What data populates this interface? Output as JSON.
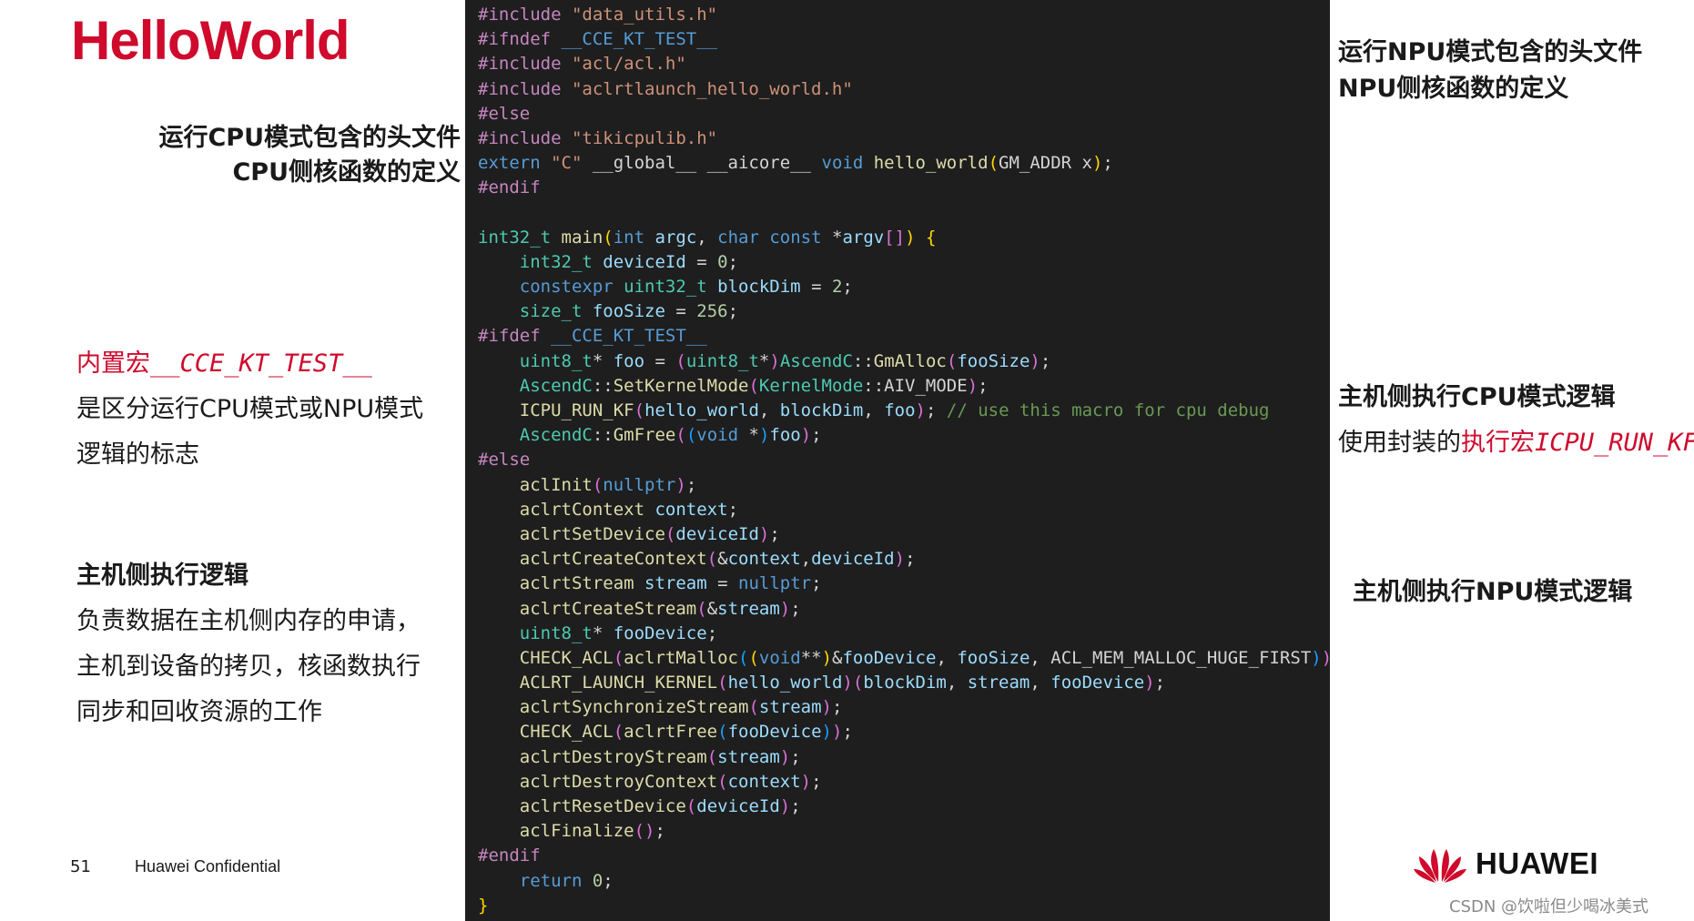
{
  "slide": {
    "title": "HelloWorld",
    "left": {
      "cpu_header_line1": "运行CPU模式包含的头文件",
      "cpu_header_line2": "CPU侧核函数的定义",
      "macro_name": "内置宏",
      "macro_code": "__CCE_KT_TEST__",
      "macro_line2": "是区分运行CPU模式或NPU模式",
      "macro_line3": "逻辑的标志",
      "host_head": "主机侧执行逻辑",
      "host_line1": "负责数据在主机侧内存的申请，",
      "host_line2": "主机到设备的拷贝，核函数执行",
      "host_line3": "同步和回收资源的工作"
    },
    "right": {
      "npu_header_line1": "运行NPU模式包含的头文件",
      "npu_header_line2": "NPU侧核函数的定义",
      "cpu_logic_head": "主机侧执行CPU模式逻辑",
      "cpu_logic_prefix": "使用封装的",
      "cpu_logic_red": "执行宏",
      "cpu_logic_code": "ICPU_RUN_KF",
      "npu_logic_head": "主机侧执行NPU模式逻辑"
    },
    "footer": {
      "page_number": "51",
      "confidential": "Huawei Confidential",
      "logo_text": "HUAWEI",
      "watermark": "CSDN @饮啦但少喝冰美式"
    }
  },
  "code": {
    "language": "cpp",
    "lines": [
      [
        [
          "pp",
          "#include "
        ],
        [
          "str",
          "\"data_utils.h\""
        ]
      ],
      [
        [
          "pp",
          "#ifndef "
        ],
        [
          "mac",
          "__CCE_KT_TEST__"
        ]
      ],
      [
        [
          "pp",
          "#include "
        ],
        [
          "str",
          "\"acl/acl.h\""
        ]
      ],
      [
        [
          "pp",
          "#include "
        ],
        [
          "str",
          "\"aclrtlaunch_hello_world.h\""
        ]
      ],
      [
        [
          "pp",
          "#else"
        ]
      ],
      [
        [
          "pp",
          "#include "
        ],
        [
          "str",
          "\"tikicpulib.h\""
        ]
      ],
      [
        [
          "kw",
          "extern "
        ],
        [
          "str",
          "\"C\" "
        ],
        [
          "pun",
          "__global__ __aicore__ "
        ],
        [
          "kw",
          "void "
        ],
        [
          "fn",
          "hello_world"
        ],
        [
          "br1",
          "("
        ],
        [
          "pun",
          "GM_ADDR x"
        ],
        [
          "br1",
          ")"
        ],
        [
          "pun",
          ";"
        ]
      ],
      [
        [
          "pp",
          "#endif"
        ]
      ],
      [],
      [
        [
          "type",
          "int32_t "
        ],
        [
          "fn",
          "main"
        ],
        [
          "br1",
          "("
        ],
        [
          "kw",
          "int "
        ],
        [
          "var",
          "argc"
        ],
        [
          "pun",
          ", "
        ],
        [
          "kw",
          "char const "
        ],
        [
          "pun",
          "*"
        ],
        [
          "var",
          "argv"
        ],
        [
          "br2",
          "[]"
        ],
        [
          "br1",
          ")"
        ],
        [
          "pun",
          " "
        ],
        [
          "br1",
          "{"
        ]
      ],
      [
        [
          "pun",
          "    "
        ],
        [
          "type",
          "int32_t "
        ],
        [
          "var",
          "deviceId"
        ],
        [
          "pun",
          " = "
        ],
        [
          "num",
          "0"
        ],
        [
          "pun",
          ";"
        ]
      ],
      [
        [
          "pun",
          "    "
        ],
        [
          "kw",
          "constexpr "
        ],
        [
          "type",
          "uint32_t "
        ],
        [
          "var",
          "blockDim"
        ],
        [
          "pun",
          " = "
        ],
        [
          "num",
          "2"
        ],
        [
          "pun",
          ";"
        ]
      ],
      [
        [
          "pun",
          "    "
        ],
        [
          "type",
          "size_t "
        ],
        [
          "var",
          "fooSize"
        ],
        [
          "pun",
          " = "
        ],
        [
          "num",
          "256"
        ],
        [
          "pun",
          ";"
        ]
      ],
      [
        [
          "pp",
          "#ifdef "
        ],
        [
          "mac",
          "__CCE_KT_TEST__"
        ]
      ],
      [
        [
          "pun",
          "    "
        ],
        [
          "type",
          "uint8_t"
        ],
        [
          "pun",
          "* "
        ],
        [
          "var",
          "foo"
        ],
        [
          "pun",
          " = "
        ],
        [
          "br2",
          "("
        ],
        [
          "type",
          "uint8_t"
        ],
        [
          "pun",
          "*"
        ],
        [
          "br2",
          ")"
        ],
        [
          "type",
          "AscendC"
        ],
        [
          "pun",
          "::"
        ],
        [
          "fn",
          "GmAlloc"
        ],
        [
          "br2",
          "("
        ],
        [
          "var",
          "fooSize"
        ],
        [
          "br2",
          ")"
        ],
        [
          "pun",
          ";"
        ]
      ],
      [
        [
          "pun",
          "    "
        ],
        [
          "type",
          "AscendC"
        ],
        [
          "pun",
          "::"
        ],
        [
          "fn",
          "SetKernelMode"
        ],
        [
          "br2",
          "("
        ],
        [
          "type",
          "KernelMode"
        ],
        [
          "pun",
          "::AIV_MODE"
        ],
        [
          "br2",
          ")"
        ],
        [
          "pun",
          ";"
        ]
      ],
      [
        [
          "pun",
          "    "
        ],
        [
          "fn",
          "ICPU_RUN_KF"
        ],
        [
          "br2",
          "("
        ],
        [
          "var",
          "hello_world"
        ],
        [
          "pun",
          ", "
        ],
        [
          "var",
          "blockDim"
        ],
        [
          "pun",
          ", "
        ],
        [
          "var",
          "foo"
        ],
        [
          "br2",
          ")"
        ],
        [
          "pun",
          "; "
        ],
        [
          "com",
          "// use this macro for cpu debug"
        ]
      ],
      [
        [
          "pun",
          "    "
        ],
        [
          "type",
          "AscendC"
        ],
        [
          "pun",
          "::"
        ],
        [
          "fn",
          "GmFree"
        ],
        [
          "br2",
          "("
        ],
        [
          "br3",
          "("
        ],
        [
          "kw",
          "void "
        ],
        [
          "pun",
          "*"
        ],
        [
          "br3",
          ")"
        ],
        [
          "var",
          "foo"
        ],
        [
          "br2",
          ")"
        ],
        [
          "pun",
          ";"
        ]
      ],
      [
        [
          "pp",
          "#else"
        ]
      ],
      [
        [
          "pun",
          "    "
        ],
        [
          "fn",
          "aclInit"
        ],
        [
          "br2",
          "("
        ],
        [
          "kw",
          "nullptr"
        ],
        [
          "br2",
          ")"
        ],
        [
          "pun",
          ";"
        ]
      ],
      [
        [
          "pun",
          "    "
        ],
        [
          "fn",
          "aclrtContext "
        ],
        [
          "var",
          "context"
        ],
        [
          "pun",
          ";"
        ]
      ],
      [
        [
          "pun",
          "    "
        ],
        [
          "fn",
          "aclrtSetDevice"
        ],
        [
          "br2",
          "("
        ],
        [
          "var",
          "deviceId"
        ],
        [
          "br2",
          ")"
        ],
        [
          "pun",
          ";"
        ]
      ],
      [
        [
          "pun",
          "    "
        ],
        [
          "fn",
          "aclrtCreateContext"
        ],
        [
          "br2",
          "("
        ],
        [
          "pun",
          "&"
        ],
        [
          "var",
          "context"
        ],
        [
          "pun",
          ","
        ],
        [
          "var",
          "deviceId"
        ],
        [
          "br2",
          ")"
        ],
        [
          "pun",
          ";"
        ]
      ],
      [
        [
          "pun",
          "    "
        ],
        [
          "fn",
          "aclrtStream "
        ],
        [
          "var",
          "stream"
        ],
        [
          "pun",
          " = "
        ],
        [
          "kw",
          "nullptr"
        ],
        [
          "pun",
          ";"
        ]
      ],
      [
        [
          "pun",
          "    "
        ],
        [
          "fn",
          "aclrtCreateStream"
        ],
        [
          "br2",
          "("
        ],
        [
          "pun",
          "&"
        ],
        [
          "var",
          "stream"
        ],
        [
          "br2",
          ")"
        ],
        [
          "pun",
          ";"
        ]
      ],
      [
        [
          "pun",
          "    "
        ],
        [
          "type",
          "uint8_t"
        ],
        [
          "pun",
          "* "
        ],
        [
          "var",
          "fooDevice"
        ],
        [
          "pun",
          ";"
        ]
      ],
      [
        [
          "pun",
          "    "
        ],
        [
          "fn",
          "CHECK_ACL"
        ],
        [
          "br2",
          "("
        ],
        [
          "fn",
          "aclrtMalloc"
        ],
        [
          "br3",
          "("
        ],
        [
          "br1",
          "("
        ],
        [
          "kw",
          "void"
        ],
        [
          "pun",
          "**"
        ],
        [
          "br1",
          ")"
        ],
        [
          "pun",
          "&"
        ],
        [
          "var",
          "fooDevice"
        ],
        [
          "pun",
          ", "
        ],
        [
          "var",
          "fooSize"
        ],
        [
          "pun",
          ", ACL_MEM_MALLOC_HUGE_FIRST"
        ],
        [
          "br3",
          ")"
        ],
        [
          "br2",
          ")"
        ],
        [
          "pun",
          ";"
        ]
      ],
      [
        [
          "pun",
          "    "
        ],
        [
          "fn",
          "ACLRT_LAUNCH_KERNEL"
        ],
        [
          "br2",
          "("
        ],
        [
          "var",
          "hello_world"
        ],
        [
          "br2",
          ")"
        ],
        [
          "br2",
          "("
        ],
        [
          "var",
          "blockDim"
        ],
        [
          "pun",
          ", "
        ],
        [
          "var",
          "stream"
        ],
        [
          "pun",
          ", "
        ],
        [
          "var",
          "fooDevice"
        ],
        [
          "br2",
          ")"
        ],
        [
          "pun",
          ";"
        ]
      ],
      [
        [
          "pun",
          "    "
        ],
        [
          "fn",
          "aclrtSynchronizeStream"
        ],
        [
          "br2",
          "("
        ],
        [
          "var",
          "stream"
        ],
        [
          "br2",
          ")"
        ],
        [
          "pun",
          ";"
        ]
      ],
      [
        [
          "pun",
          "    "
        ],
        [
          "fn",
          "CHECK_ACL"
        ],
        [
          "br2",
          "("
        ],
        [
          "fn",
          "aclrtFree"
        ],
        [
          "br3",
          "("
        ],
        [
          "var",
          "fooDevice"
        ],
        [
          "br3",
          ")"
        ],
        [
          "br2",
          ")"
        ],
        [
          "pun",
          ";"
        ]
      ],
      [
        [
          "pun",
          "    "
        ],
        [
          "fn",
          "aclrtDestroyStream"
        ],
        [
          "br2",
          "("
        ],
        [
          "var",
          "stream"
        ],
        [
          "br2",
          ")"
        ],
        [
          "pun",
          ";"
        ]
      ],
      [
        [
          "pun",
          "    "
        ],
        [
          "fn",
          "aclrtDestroyContext"
        ],
        [
          "br2",
          "("
        ],
        [
          "var",
          "context"
        ],
        [
          "br2",
          ")"
        ],
        [
          "pun",
          ";"
        ]
      ],
      [
        [
          "pun",
          "    "
        ],
        [
          "fn",
          "aclrtResetDevice"
        ],
        [
          "br2",
          "("
        ],
        [
          "var",
          "deviceId"
        ],
        [
          "br2",
          ")"
        ],
        [
          "pun",
          ";"
        ]
      ],
      [
        [
          "pun",
          "    "
        ],
        [
          "fn",
          "aclFinalize"
        ],
        [
          "br2",
          "()"
        ],
        [
          "pun",
          ";"
        ]
      ],
      [
        [
          "pp",
          "#endif"
        ]
      ],
      [
        [
          "pun",
          "    "
        ],
        [
          "kw",
          "return "
        ],
        [
          "num",
          "0"
        ],
        [
          "pun",
          ";"
        ]
      ],
      [
        [
          "br1",
          "}"
        ]
      ]
    ]
  }
}
